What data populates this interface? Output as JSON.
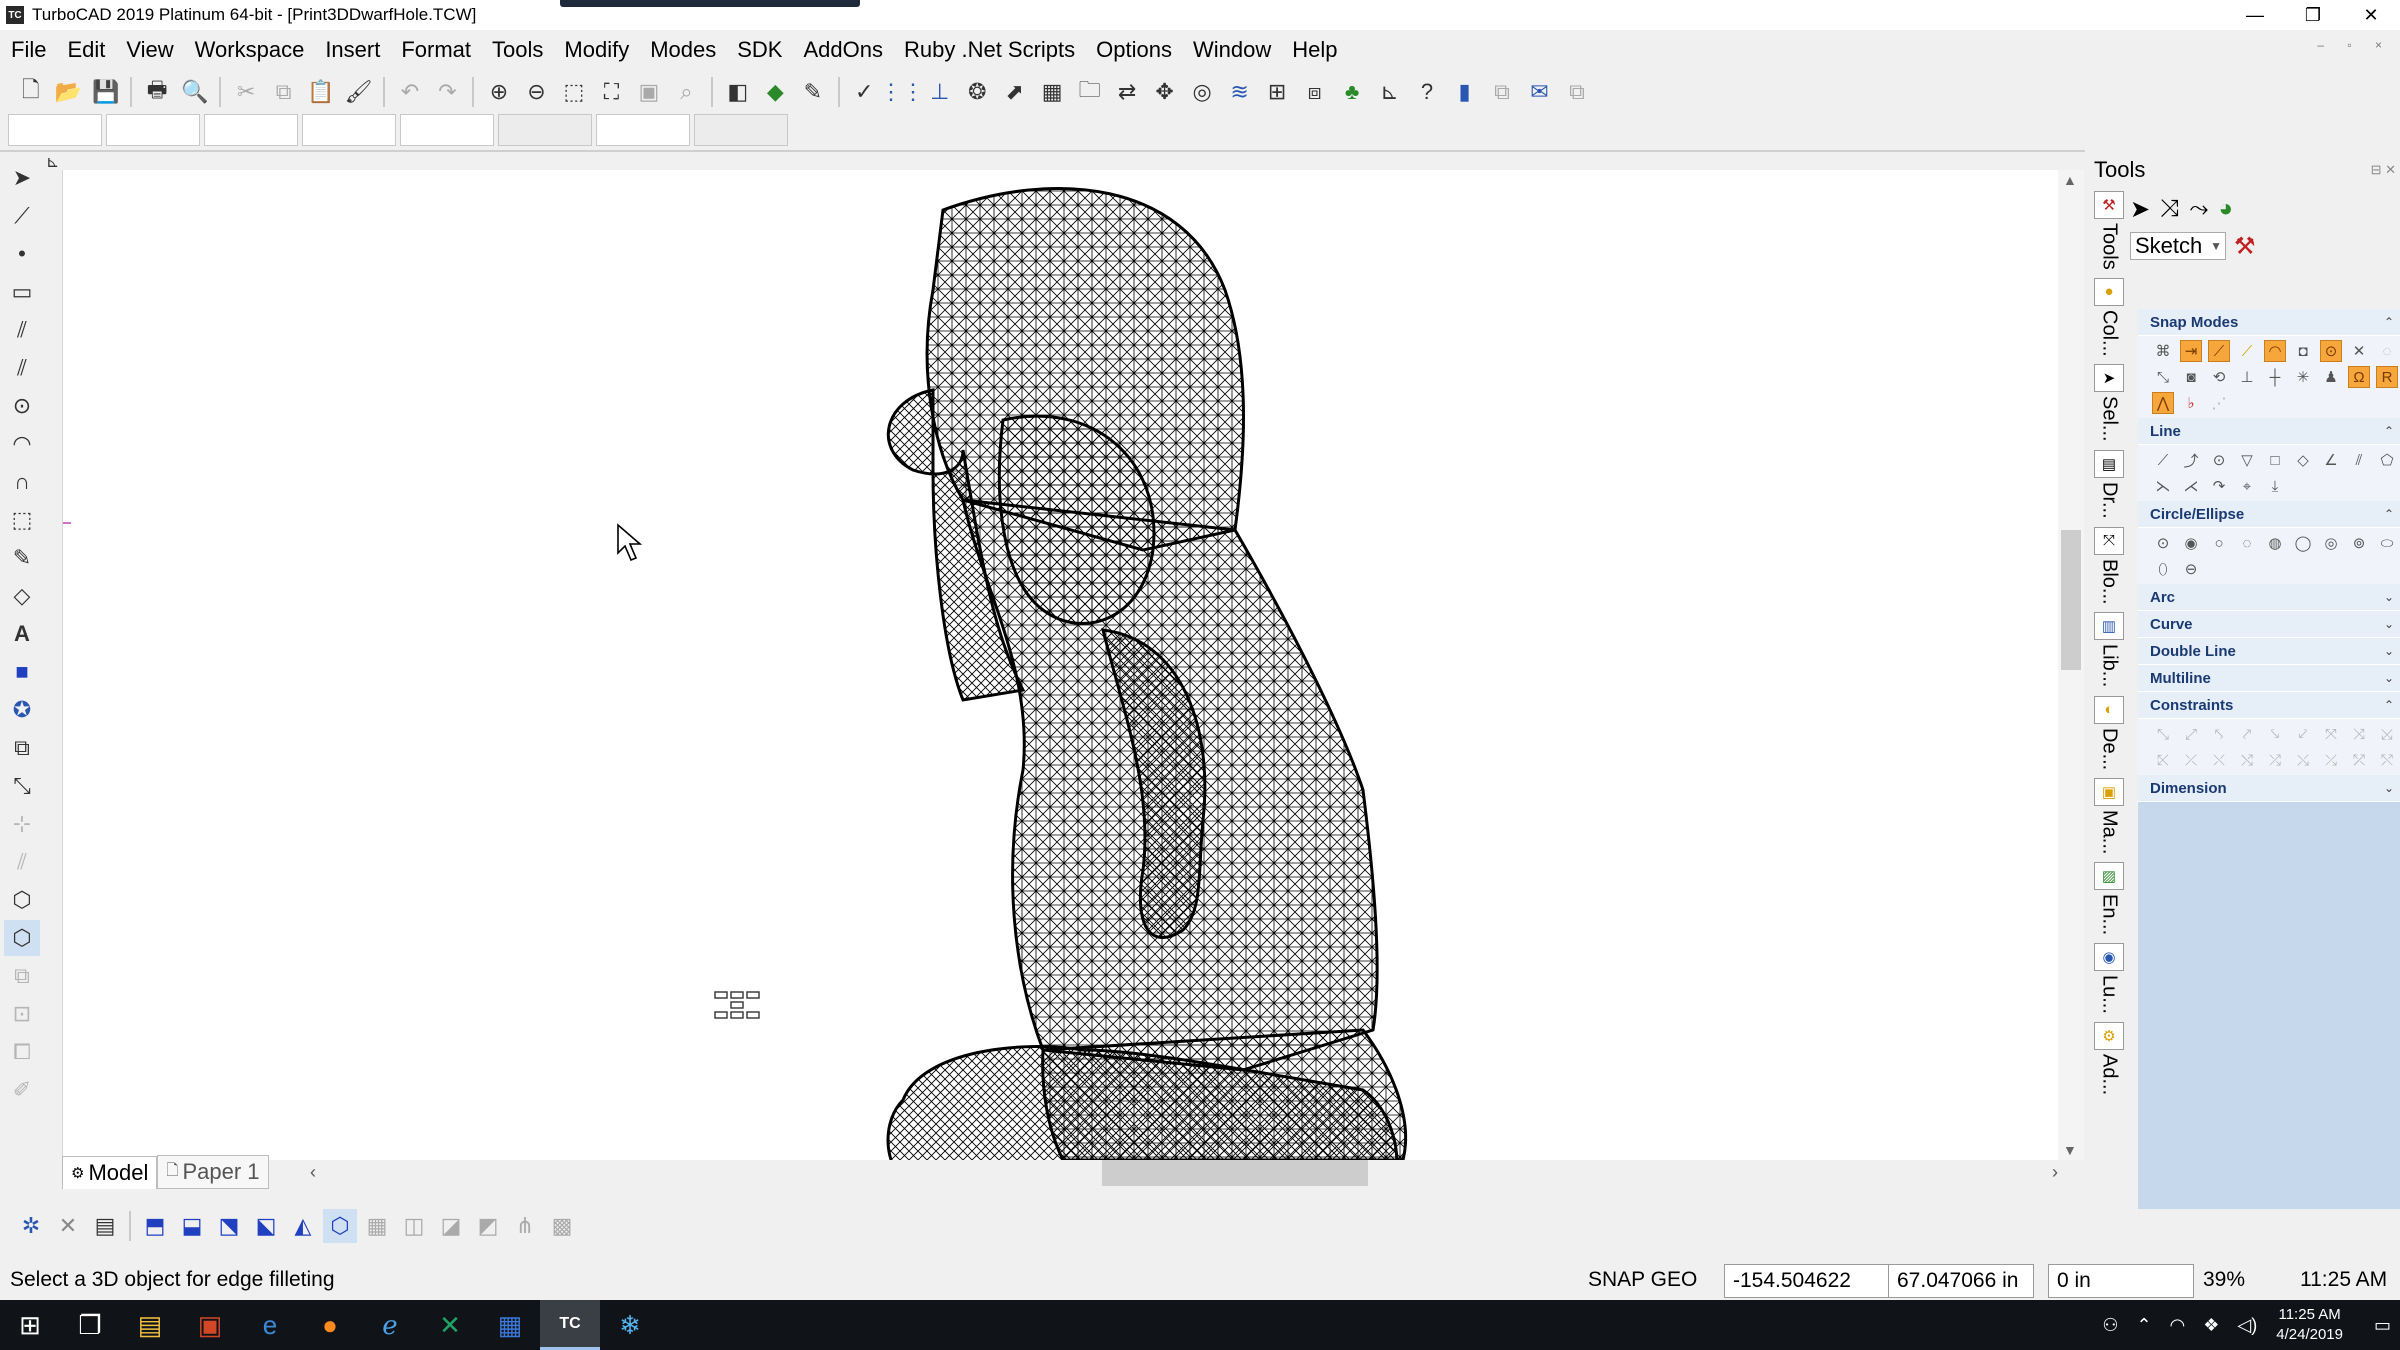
{
  "window": {
    "title": "TurboCAD 2019 Platinum 64-bit - [Print3DDwarfHole.TCW]",
    "app_icon": "TC",
    "minimize": "—",
    "restore": "❐",
    "close": "✕"
  },
  "menu": [
    "File",
    "Edit",
    "View",
    "Workspace",
    "Insert",
    "Format",
    "Tools",
    "Modify",
    "Modes",
    "SDK",
    "AddOns",
    "Ruby .Net Scripts",
    "Options",
    "Window",
    "Help"
  ],
  "tools_panel": {
    "title": "Tools",
    "mode_select": "Sketch",
    "vertical_tabs": [
      "Tools",
      "Col...",
      "Sel...",
      "Dr...",
      "Blo...",
      "Lib...",
      "De...",
      "Ma...",
      "En...",
      "Lu...",
      "Ad..."
    ],
    "sections": [
      {
        "label": "Snap Modes",
        "expanded": true
      },
      {
        "label": "Line",
        "expanded": true
      },
      {
        "label": "Circle/Ellipse",
        "expanded": true
      },
      {
        "label": "Arc",
        "expanded": false
      },
      {
        "label": "Curve",
        "expanded": false
      },
      {
        "label": "Double Line",
        "expanded": false
      },
      {
        "label": "Multiline",
        "expanded": false
      },
      {
        "label": "Constraints",
        "expanded": true
      },
      {
        "label": "Dimension",
        "expanded": false
      }
    ]
  },
  "tabs": {
    "model": "Model",
    "paper": "Paper 1"
  },
  "status": {
    "message": "Select a 3D object for edge filleting",
    "snap": "SNAP GEO",
    "x": "-154.504622",
    "y": "67.047066 in",
    "z": "0 in",
    "zoom": "39%",
    "time": "11:25 AM"
  },
  "taskbar": {
    "clock_time": "11:25 AM",
    "clock_date": "4/24/2019",
    "apps": [
      "windows-start",
      "task-view",
      "outlook",
      "powerpoint",
      "edge",
      "firefox",
      "internet-explorer",
      "excel",
      "outlook-2",
      "turbocad",
      "snowflake-app"
    ]
  },
  "colors": {
    "section_bg": "#c6d8ec",
    "section_header_text": "#1a3a72",
    "snap_active": "#f6a63a",
    "taskbar": "#101418"
  }
}
